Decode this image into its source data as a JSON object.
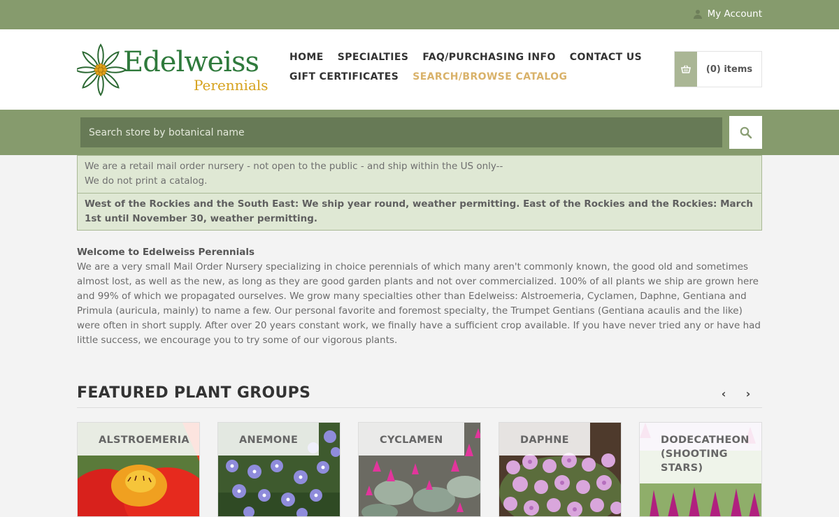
{
  "topbar": {
    "account_label": "My Account"
  },
  "brand": {
    "name_line1": "Edelweiss",
    "name_line2": "Perennials"
  },
  "nav": {
    "row1": [
      "HOME",
      "SPECIALTIES",
      "FAQ/PURCHASING INFO",
      "CONTACT US"
    ],
    "row2": [
      "GIFT CERTIFICATES",
      "SEARCH/BROWSE CATALOG"
    ],
    "active": "SEARCH/BROWSE CATALOG"
  },
  "cart": {
    "label": "(0) items",
    "icon": "basket-icon"
  },
  "search": {
    "placeholder": "Search store by botanical name",
    "value": "",
    "icon": "search-icon"
  },
  "notices": {
    "retail_line1": "We are a retail mail order nursery - not open to the public - and ship within the US only--",
    "retail_line2": "We do not print a catalog.",
    "shipping": "West of the Rockies and the South East: We ship year round, weather permitting. East of the Rockies and the Rockies: March 1st until November 30, weather permitting."
  },
  "welcome": {
    "heading": "Welcome to Edelweiss Perennials",
    "body": "We are a very small Mail Order Nursery specializing in choice perennials of which many aren't commonly known, the good old and sometimes almost lost, as well as the new, as long as they are good garden plants and not over commercialized. 100% of all plants we ship are grown here and 99% of which we propagated ourselves. We grow many specialties other than Edelweiss: Alstroemeria, Cyclamen, Daphne, Gentiana and Primula (auricula, mainly) to name a few. Our personal favorite and foremost specialty, the Trumpet Gentians (Gentiana acaulis and the like) were often in short supply. After over 20 years constant work, we finally have a sufficient crop available. If you have never tried any or have had little success, we encourage you to try some of our vigorous plants."
  },
  "featured": {
    "title": "FEATURED PLANT GROUPS",
    "prev_icon": "chevron-left-icon",
    "next_icon": "chevron-right-icon",
    "groups": [
      "ALSTROEMERIA",
      "ANEMONE",
      "CYCLAMEN",
      "DAPHNE",
      "DODECATHEON (SHOOTING STARS)"
    ]
  },
  "colors": {
    "brand_green": "#869b6d",
    "search_field": "#677a56",
    "notice_bg": "#dfe8d4",
    "active_nav": "#d9b26a"
  }
}
